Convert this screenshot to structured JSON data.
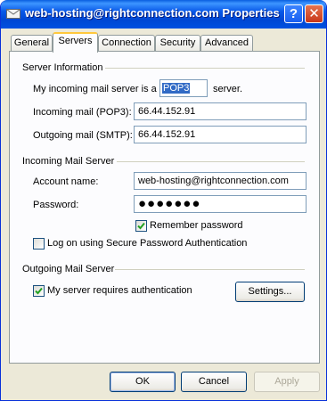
{
  "window": {
    "title": "web-hosting@rightconnection.com Properties",
    "help_glyph": "?",
    "close_glyph": "✕"
  },
  "tabs": [
    "General",
    "Servers",
    "Connection",
    "Security",
    "Advanced"
  ],
  "active_tab": "Servers",
  "server_info": {
    "heading": "Server Information",
    "incoming_type_prefix": "My incoming mail server is a",
    "incoming_type_value": "POP3",
    "incoming_type_suffix": "server.",
    "incoming_label": "Incoming mail (POP3):",
    "incoming_value": "66.44.152.91",
    "outgoing_label": "Outgoing mail (SMTP):",
    "outgoing_value": "66.44.152.91"
  },
  "incoming_server": {
    "heading": "Incoming Mail Server",
    "account_label": "Account name:",
    "account_value": "web-hosting@rightconnection.com",
    "password_label": "Password:",
    "password_value": "●●●●●●●",
    "remember_label": "Remember password",
    "remember_checked": true,
    "spa_label": "Log on using Secure Password Authentication",
    "spa_checked": false
  },
  "outgoing_server": {
    "heading": "Outgoing Mail Server",
    "auth_label": "My server requires authentication",
    "auth_checked": true,
    "settings_button": "Settings..."
  },
  "buttons": {
    "ok": "OK",
    "cancel": "Cancel",
    "apply": "Apply"
  },
  "colors": {
    "titlebar": "#0054e3",
    "dialog_bg": "#ece9d8",
    "check": "#21a121",
    "selection": "#316ac5"
  }
}
